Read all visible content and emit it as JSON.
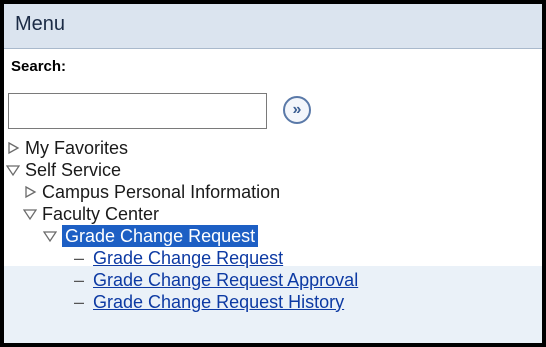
{
  "menu": {
    "title": "Menu"
  },
  "search": {
    "label": "Search:",
    "value": "",
    "placeholder": "",
    "go_icon": "double-chevron-right-icon"
  },
  "tree": {
    "my_favorites": "My Favorites",
    "self_service": "Self Service",
    "campus_personal_information": "Campus Personal Information",
    "faculty_center": "Faculty Center",
    "grade_change_request_folder": "Grade Change Request",
    "links": [
      {
        "label": "Grade Change Request"
      },
      {
        "label": "Grade Change Request Approval"
      },
      {
        "label": "Grade Change Request History"
      }
    ]
  },
  "colors": {
    "header_bg": "#dbe4ef",
    "selected_bg": "#1d5fc4",
    "link": "#0d3aa3",
    "subtree_bg": "#eaf1f8"
  }
}
